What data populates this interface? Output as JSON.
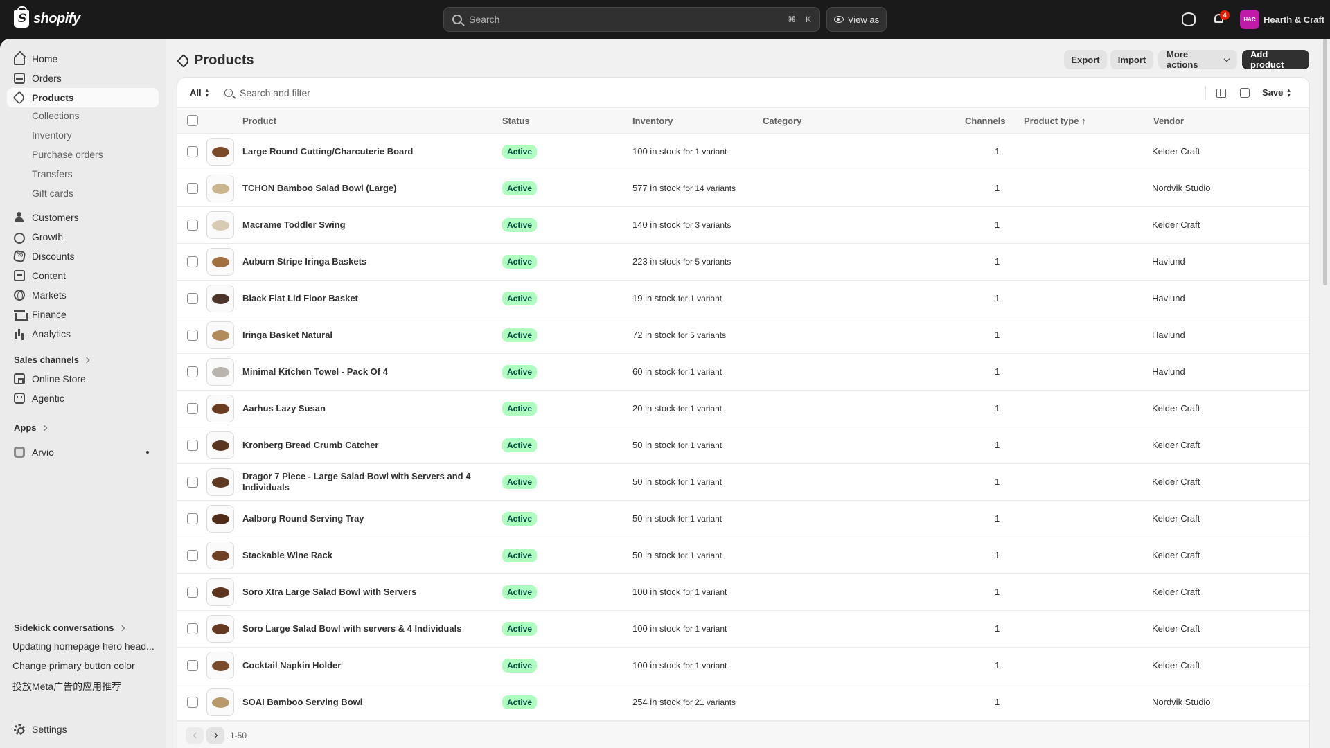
{
  "topbar": {
    "brand": "shopify",
    "search_placeholder": "Search",
    "shortcut_cmd": "⌘",
    "shortcut_key": "K",
    "view_as": "View as",
    "notification_count": "4",
    "store_initials": "H&C",
    "store_name": "Hearth & Craft",
    "avatar_color": "#c01ba8"
  },
  "sidebar": {
    "main_items": [
      {
        "label": "Home",
        "icon": "home-icon"
      },
      {
        "label": "Orders",
        "icon": "orders-icon"
      },
      {
        "label": "Products",
        "icon": "tag-icon",
        "active": true
      }
    ],
    "product_sub": [
      "Collections",
      "Inventory",
      "Purchase orders",
      "Transfers",
      "Gift cards"
    ],
    "more_items": [
      {
        "label": "Customers",
        "icon": "person-icon"
      },
      {
        "label": "Growth",
        "icon": "growth-icon"
      },
      {
        "label": "Discounts",
        "icon": "discount-icon"
      },
      {
        "label": "Content",
        "icon": "content-icon"
      },
      {
        "label": "Markets",
        "icon": "globe-icon"
      },
      {
        "label": "Finance",
        "icon": "bank-icon"
      },
      {
        "label": "Analytics",
        "icon": "bar-chart-icon"
      }
    ],
    "sales_channels_heading": "Sales channels",
    "sales_channels": [
      {
        "label": "Online Store",
        "icon": "store-icon"
      },
      {
        "label": "Agentic",
        "icon": "agent-icon"
      }
    ],
    "apps_heading": "Apps",
    "apps": [
      {
        "label": "Arvio",
        "icon": "app-icon"
      }
    ],
    "sidekick_heading": "Sidekick conversations",
    "sidekick_items": [
      "Updating homepage hero head...",
      "Change primary button color",
      "投放Meta广告的应用推荐"
    ],
    "settings": "Settings"
  },
  "page": {
    "title": "Products",
    "export": "Export",
    "import": "Import",
    "more_actions": "More actions",
    "add_product": "Add product"
  },
  "filter": {
    "tab": "All",
    "search_placeholder": "Search and filter",
    "save": "Save"
  },
  "columns": {
    "product": "Product",
    "status": "Status",
    "inventory": "Inventory",
    "category": "Category",
    "channels": "Channels",
    "product_type": "Product type ↑",
    "vendor": "Vendor"
  },
  "products": [
    {
      "name": "Large Round Cutting/Charcuterie Board",
      "status": "Active",
      "stock": "100 in stock",
      "variants": "for 1 variant",
      "channels": "1",
      "vendor": "Kelder Craft",
      "color": "#7a4a2a"
    },
    {
      "name": "TCHON Bamboo Salad Bowl (Large)",
      "status": "Active",
      "stock": "577 in stock",
      "variants": "for 14 variants",
      "channels": "1",
      "vendor": "Nordvik Studio",
      "color": "#c9b68f"
    },
    {
      "name": "Macrame Toddler Swing",
      "status": "Active",
      "stock": "140 in stock",
      "variants": "for 3 variants",
      "channels": "1",
      "vendor": "Kelder Craft",
      "color": "#d8cbb3"
    },
    {
      "name": "Auburn Stripe Iringa Baskets",
      "status": "Active",
      "stock": "223 in stock",
      "variants": "for 5 variants",
      "channels": "1",
      "vendor": "Havlund",
      "color": "#a0703f"
    },
    {
      "name": "Black Flat Lid Floor Basket",
      "status": "Active",
      "stock": "19 in stock",
      "variants": "for 1 variant",
      "channels": "1",
      "vendor": "Havlund",
      "color": "#4a3528"
    },
    {
      "name": "Iringa Basket Natural",
      "status": "Active",
      "stock": "72 in stock",
      "variants": "for 5 variants",
      "channels": "1",
      "vendor": "Havlund",
      "color": "#b08c5a"
    },
    {
      "name": "Minimal Kitchen Towel - Pack Of 4",
      "status": "Active",
      "stock": "60 in stock",
      "variants": "for 1 variant",
      "channels": "1",
      "vendor": "Havlund",
      "color": "#b9b4ad"
    },
    {
      "name": "Aarhus Lazy Susan",
      "status": "Active",
      "stock": "20 in stock",
      "variants": "for 1 variant",
      "channels": "1",
      "vendor": "Kelder Craft",
      "color": "#6a3d22"
    },
    {
      "name": "Kronberg Bread Crumb Catcher",
      "status": "Active",
      "stock": "50 in stock",
      "variants": "for 1 variant",
      "channels": "1",
      "vendor": "Kelder Craft",
      "color": "#5a3520"
    },
    {
      "name": "Dragor 7 Piece - Large Salad Bowl with Servers and 4 Individuals",
      "status": "Active",
      "stock": "50 in stock",
      "variants": "for 1 variant",
      "channels": "1",
      "vendor": "Kelder Craft",
      "color": "#5e3a22"
    },
    {
      "name": "Aalborg Round Serving Tray",
      "status": "Active",
      "stock": "50 in stock",
      "variants": "for 1 variant",
      "channels": "1",
      "vendor": "Kelder Craft",
      "color": "#4e2c18"
    },
    {
      "name": "Stackable Wine Rack",
      "status": "Active",
      "stock": "50 in stock",
      "variants": "for 1 variant",
      "channels": "1",
      "vendor": "Kelder Craft",
      "color": "#6e4126"
    },
    {
      "name": "Soro Xtra Large Salad Bowl with Servers",
      "status": "Active",
      "stock": "100 in stock",
      "variants": "for 1 variant",
      "channels": "1",
      "vendor": "Kelder Craft",
      "color": "#5c341e"
    },
    {
      "name": "Soro Large Salad Bowl with servers & 4 Individuals",
      "status": "Active",
      "stock": "100 in stock",
      "variants": "for 1 variant",
      "channels": "1",
      "vendor": "Kelder Craft",
      "color": "#633a21"
    },
    {
      "name": "Cocktail Napkin Holder",
      "status": "Active",
      "stock": "100 in stock",
      "variants": "for 1 variant",
      "channels": "1",
      "vendor": "Kelder Craft",
      "color": "#7a4a2c"
    },
    {
      "name": "SOAI Bamboo Serving Bowl",
      "status": "Active",
      "stock": "254 in stock",
      "variants": "for 21 variants",
      "channels": "1",
      "vendor": "Nordvik Studio",
      "color": "#b89a6a"
    }
  ],
  "pagination": {
    "range": "1-50"
  }
}
